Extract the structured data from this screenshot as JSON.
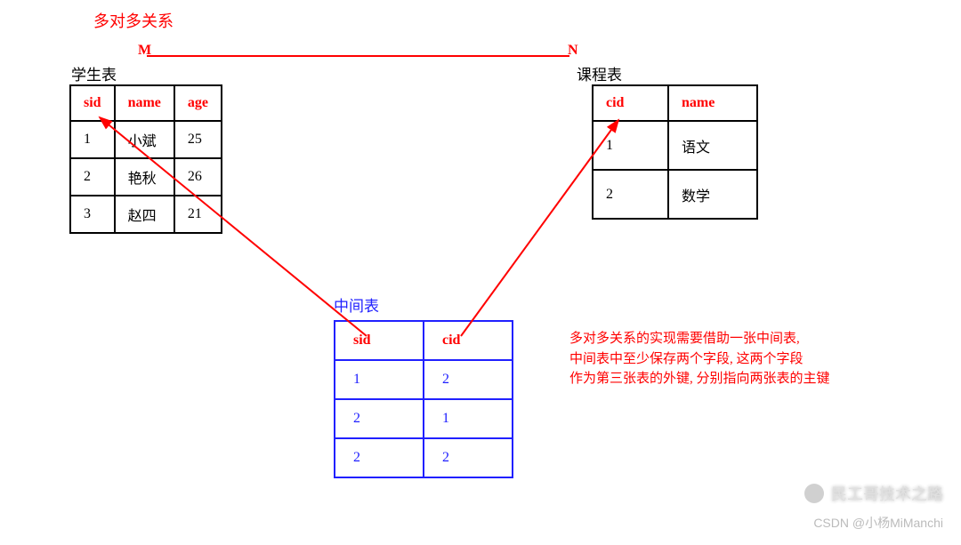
{
  "title": "多对多关系",
  "relation": {
    "m_label": "M",
    "n_label": "N"
  },
  "student_table": {
    "label": "学生表",
    "headers": [
      "sid",
      "name",
      "age"
    ],
    "rows": [
      [
        "1",
        "小斌",
        "25"
      ],
      [
        "2",
        "艳秋",
        "26"
      ],
      [
        "3",
        "赵四",
        "21"
      ]
    ]
  },
  "course_table": {
    "label": "课程表",
    "headers": [
      "cid",
      "name"
    ],
    "rows": [
      [
        "1",
        "语文"
      ],
      [
        "2",
        "数学"
      ]
    ]
  },
  "junction_table": {
    "label": "中间表",
    "headers": [
      "sid",
      "cid"
    ],
    "rows": [
      [
        "1",
        "2"
      ],
      [
        "2",
        "1"
      ],
      [
        "2",
        "2"
      ]
    ]
  },
  "description": {
    "line1": "多对多关系的实现需要借助一张中间表,",
    "line2": "中间表中至少保存两个字段, 这两个字段",
    "line3": "作为第三张表的外键, 分别指向两张表的主键"
  },
  "watermark_brand": "民工哥技术之路",
  "watermark_csdn": "CSDN @小杨MiManchi",
  "chart_data": {
    "type": "diagram",
    "relationship": "many-to-many",
    "tables": {
      "student": {
        "pk": "sid",
        "columns": [
          "sid",
          "name",
          "age"
        ],
        "rows": [
          [
            1,
            "小斌",
            25
          ],
          [
            2,
            "艳秋",
            26
          ],
          [
            3,
            "赵四",
            21
          ]
        ]
      },
      "course": {
        "pk": "cid",
        "columns": [
          "cid",
          "name"
        ],
        "rows": [
          [
            1,
            "语文"
          ],
          [
            2,
            "数学"
          ]
        ]
      },
      "junction": {
        "columns": [
          "sid",
          "cid"
        ],
        "rows": [
          [
            1,
            2
          ],
          [
            2,
            1
          ],
          [
            2,
            2
          ]
        ],
        "fk": [
          {
            "col": "sid",
            "ref": "student.sid"
          },
          {
            "col": "cid",
            "ref": "course.cid"
          }
        ]
      }
    }
  }
}
